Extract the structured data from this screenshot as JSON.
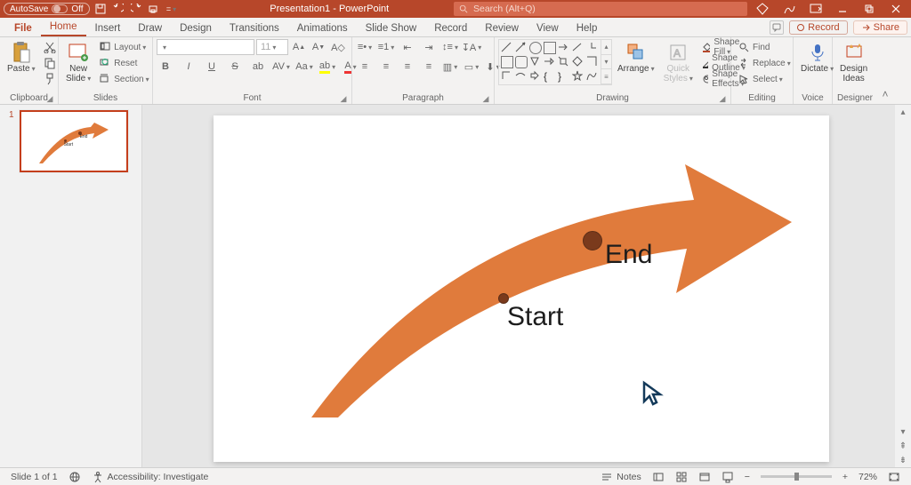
{
  "titlebar": {
    "autosave_label": "AutoSave",
    "autosave_state": "Off",
    "document_name": "Presentation1 - PowerPoint",
    "search_placeholder": "Search (Alt+Q)"
  },
  "tabs": {
    "file": "File",
    "items": [
      "Home",
      "Insert",
      "Draw",
      "Design",
      "Transitions",
      "Animations",
      "Slide Show",
      "Record",
      "Review",
      "View",
      "Help"
    ],
    "active": "Home",
    "record_label": "Record",
    "share_label": "Share"
  },
  "ribbon": {
    "clipboard": {
      "label": "Clipboard",
      "paste": "Paste"
    },
    "slides": {
      "label": "Slides",
      "new_slide": "New\nSlide",
      "layout": "Layout",
      "reset": "Reset",
      "section": "Section"
    },
    "font": {
      "label": "Font",
      "size_placeholder": "11",
      "bold": "B",
      "italic": "I",
      "underline": "U",
      "strike": "S"
    },
    "paragraph": {
      "label": "Paragraph"
    },
    "drawing": {
      "label": "Drawing",
      "arrange": "Arrange",
      "quick_styles": "Quick\nStyles",
      "shape_fill": "Shape Fill",
      "shape_outline": "Shape Outline",
      "shape_effects": "Shape Effects"
    },
    "editing": {
      "label": "Editing",
      "find": "Find",
      "replace": "Replace",
      "select": "Select"
    },
    "voice": {
      "label": "Voice",
      "dictate": "Dictate"
    },
    "designer": {
      "label": "Designer",
      "design_ideas": "Design\nIdeas"
    }
  },
  "slide": {
    "start_label": "Start",
    "end_label": "End",
    "thumb_start": "Start",
    "thumb_end": "End",
    "thumb_number": "1"
  },
  "status": {
    "slide_indicator": "Slide 1 of 1",
    "accessibility": "Accessibility: Investigate",
    "notes": "Notes",
    "zoom": "72%"
  }
}
